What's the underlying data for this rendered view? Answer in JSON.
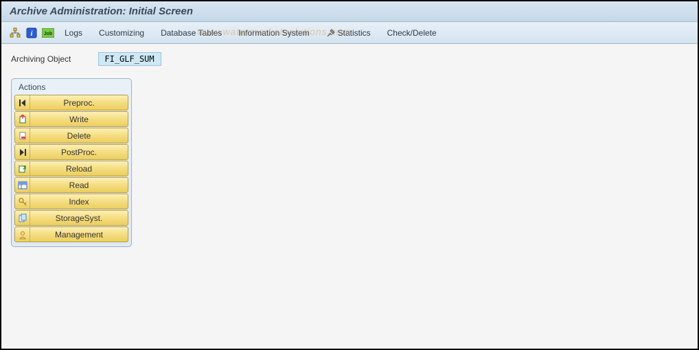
{
  "header": {
    "title": "Archive Administration: Initial Screen"
  },
  "toolbar": {
    "icons": [
      {
        "name": "hierarchy-icon",
        "glyph": "hierarchy"
      },
      {
        "name": "info-icon",
        "glyph": "info"
      },
      {
        "name": "job-icon",
        "glyph": "job"
      }
    ],
    "items": [
      {
        "label": "Logs"
      },
      {
        "label": "Customizing"
      },
      {
        "label": "Database Tables"
      },
      {
        "label": "Information System"
      },
      {
        "label": "Statistics",
        "icon": "tools-icon"
      },
      {
        "label": "Check/Delete"
      }
    ]
  },
  "watermark": "www.watermarketsolutions.com",
  "field": {
    "label": "Archiving Object",
    "value": "FI_GLF_SUM"
  },
  "actions": {
    "title": "Actions",
    "buttons": [
      {
        "icon": "first-icon",
        "label": "Preproc."
      },
      {
        "icon": "export-icon",
        "label": "Write"
      },
      {
        "icon": "delete-file-icon",
        "label": "Delete"
      },
      {
        "icon": "last-icon",
        "label": "PostProc."
      },
      {
        "icon": "reload-icon",
        "label": "Reload"
      },
      {
        "icon": "read-table-icon",
        "label": "Read"
      },
      {
        "icon": "index-key-icon",
        "label": "Index"
      },
      {
        "icon": "storage-icon",
        "label": "StorageSyst."
      },
      {
        "icon": "management-icon",
        "label": "Management"
      }
    ]
  },
  "colors": {
    "header_bg": "#d9e6f2",
    "button_bg": "#f5dd82",
    "field_bg": "#cfe8f5"
  }
}
